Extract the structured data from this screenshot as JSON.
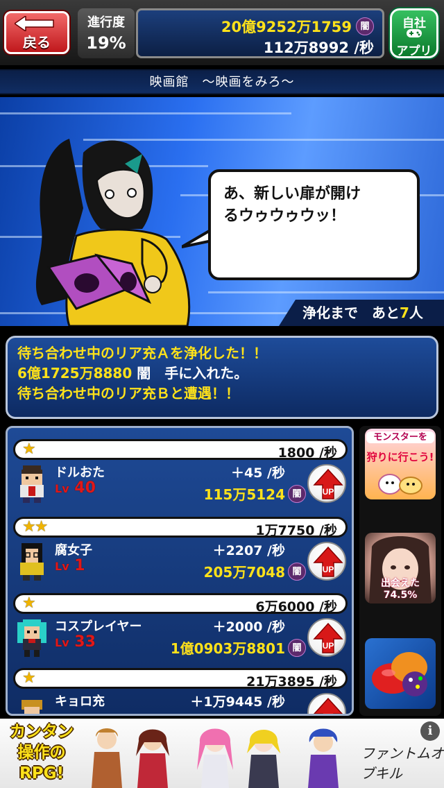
{
  "header": {
    "back_label": "戻る",
    "progress_label": "進行度",
    "progress_value": "19%",
    "total_money": "20億9252万1759",
    "money_badge": "闇",
    "per_sec": "112万8992 /秒",
    "ad_app_label_1": "自社",
    "ad_app_label_2": "アプリ"
  },
  "location": {
    "title": "映画館　～映画をみろ～"
  },
  "scene": {
    "speech_line_1": "あ、新しい扉が開け",
    "speech_line_2": "るウゥウゥウッ！",
    "purify_prefix": "浄化まで　あと",
    "purify_count": "7",
    "purify_suffix": "人"
  },
  "messages": {
    "line1": "待ち合わせ中のリア充Ａを浄化した！！",
    "line2_amount": "6億1725万8880",
    "line2_rest": " 闇　手に入れた。",
    "line3": "待ち合わせ中のリア充Ｂと遭遇！！"
  },
  "units": [
    {
      "stars": "★",
      "base_rate": "1800 /秒",
      "name": "ドルおた",
      "level_prefix": "Lv",
      "level": "40",
      "increase": "＋45 /秒",
      "cost": "115万5124",
      "badge": "闇",
      "up_label": "UP"
    },
    {
      "stars": "★★",
      "base_rate": "1万7750 /秒",
      "name": "腐女子",
      "level_prefix": "Lv",
      "level": "1",
      "increase": "＋2207 /秒",
      "cost": "205万7048",
      "badge": "闇",
      "up_label": "UP"
    },
    {
      "stars": "★",
      "base_rate": "6万6000 /秒",
      "name": "コスプレイヤー",
      "level_prefix": "Lv",
      "level": "33",
      "increase": "＋2000 /秒",
      "cost": "1億0903万8801",
      "badge": "闇",
      "up_label": "UP"
    },
    {
      "stars": "★",
      "base_rate": "21万3895 /秒",
      "name": "キョロ充",
      "level_prefix": "Lv",
      "level": "",
      "increase": "＋1万9445 /秒",
      "cost": "",
      "badge": "",
      "up_label": "UP"
    }
  ],
  "side_ads": {
    "ad1_line1": "モンスターを",
    "ad1_line2": "狩りに行こう!",
    "ad2_text": "出会えた74.5%"
  },
  "banner": {
    "copy_line1": "カンタン",
    "copy_line2": "操作の",
    "copy_line3": "RPG!",
    "logo": "ファントムオブキル",
    "info_icon": "i"
  },
  "colors": {
    "accent_yellow": "#ffe21a",
    "level_red": "#e01818",
    "panel_blue": "#1e4c9a",
    "back_red": "#c0181c",
    "app_green": "#0b7a2c"
  },
  "icons": [
    "back-arrow-icon",
    "star-icon",
    "up-arrow-icon",
    "dark-coin-icon",
    "gamepad-icon",
    "info-icon"
  ]
}
